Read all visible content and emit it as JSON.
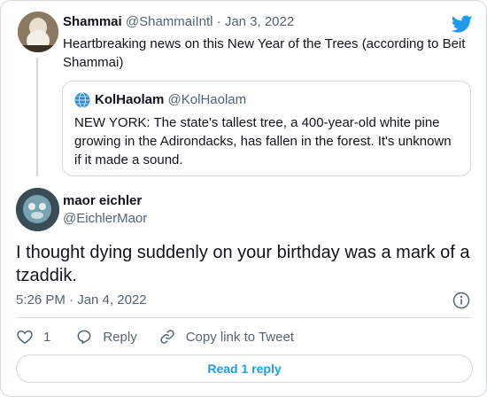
{
  "brand_color": "#1d9bf0",
  "parent_tweet": {
    "avatar_icon": "avatar-portrait",
    "name": "Shammai",
    "handle": "@ShammaiIntl",
    "separator": "·",
    "date": "Jan 3, 2022",
    "text": "Heartbreaking news on this New Year of the Trees (according to Beit Shammai)"
  },
  "quoted_tweet": {
    "avatar_icon": "globe-icon",
    "name": "KolHaolam",
    "handle": "@KolHaolam",
    "text": "NEW YORK: The state's tallest tree, a 400-year-old white pine growing in the Adirondacks, has fallen in the forest. It's unknown if it made a sound."
  },
  "main_tweet": {
    "avatar_icon": "avatar-photo",
    "name": "maor eichler",
    "handle": "@EichlerMaor",
    "text": "I thought dying suddenly on your birthday was a mark of a tzaddik.",
    "timestamp": "5:26 PM · Jan 4, 2022"
  },
  "actions": {
    "like_count": "1",
    "reply_label": "Reply",
    "copy_link_label": "Copy link to Tweet"
  },
  "read_replies_label": "Read 1 reply"
}
